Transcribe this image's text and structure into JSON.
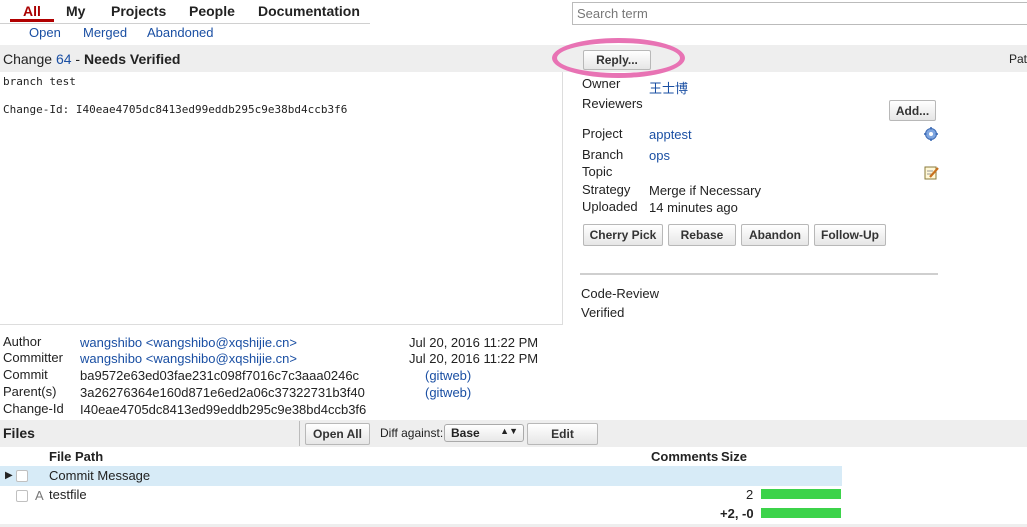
{
  "nav": {
    "tabs": [
      {
        "label": "All",
        "active": true
      },
      {
        "label": "My"
      },
      {
        "label": "Projects"
      },
      {
        "label": "People"
      },
      {
        "label": "Documentation"
      }
    ],
    "subtabs": [
      "Open",
      "Merged",
      "Abandoned"
    ]
  },
  "search": {
    "placeholder": "Search term"
  },
  "change": {
    "prefix": "Change ",
    "number": "64",
    "separator": " - ",
    "status": "Needs Verified",
    "reply_label": "Reply...",
    "patch_label": "Pat",
    "message_line1": "branch test",
    "message_line2": "Change-Id: I40eae4705dc8413ed99eddb295c9e38bd4ccb3f6"
  },
  "info": {
    "owner_label": "Owner",
    "owner_value": "王士博",
    "reviewers_label": "Reviewers",
    "add_label": "Add...",
    "project_label": "Project",
    "project_value": "apptest",
    "branch_label": "Branch",
    "branch_value": "ops",
    "topic_label": "Topic",
    "strategy_label": "Strategy",
    "strategy_value": "Merge if Necessary",
    "uploaded_label": "Uploaded",
    "uploaded_value": "14 minutes ago",
    "actions": [
      "Cherry Pick",
      "Rebase",
      "Abandon",
      "Follow-Up"
    ],
    "labels": [
      "Code-Review",
      "Verified"
    ]
  },
  "commit": {
    "author_label": "Author",
    "author_value": "wangshibo <wangshibo@xqshijie.cn>",
    "author_date": "Jul 20, 2016 11:22 PM",
    "committer_label": "Committer",
    "committer_value": "wangshibo <wangshibo@xqshijie.cn>",
    "committer_date": "Jul 20, 2016 11:22 PM",
    "commit_label": "Commit",
    "commit_value": "ba9572e63ed03fae231c098f7016c7c3aaa0246c",
    "commit_link": "(gitweb)",
    "parent_label": "Parent(s)",
    "parent_value": "3a26276364e160d871e6ed2a06c37322731b3f40",
    "parent_link": "(gitweb)",
    "changeid_label": "Change-Id",
    "changeid_value": "I40eae4705dc8413ed99eddb295c9e38bd4ccb3f6"
  },
  "files": {
    "title": "Files",
    "open_all_label": "Open All",
    "diff_against_label": "Diff against:",
    "diff_base_value": "Base",
    "edit_label": "Edit",
    "col_path": "File Path",
    "col_comments": "Comments",
    "col_size": "Size",
    "rows": [
      {
        "status": "",
        "path": "Commit Message",
        "size": ""
      },
      {
        "status": "A",
        "path": "testfile",
        "size": "2"
      }
    ],
    "total": "+2, -0"
  },
  "colors": {
    "accent": "#b10000",
    "link": "#1a4fa3",
    "highlight_row": "#d7ebf7",
    "size_bar": "#3cd34a",
    "annotation": "#e873b4"
  }
}
